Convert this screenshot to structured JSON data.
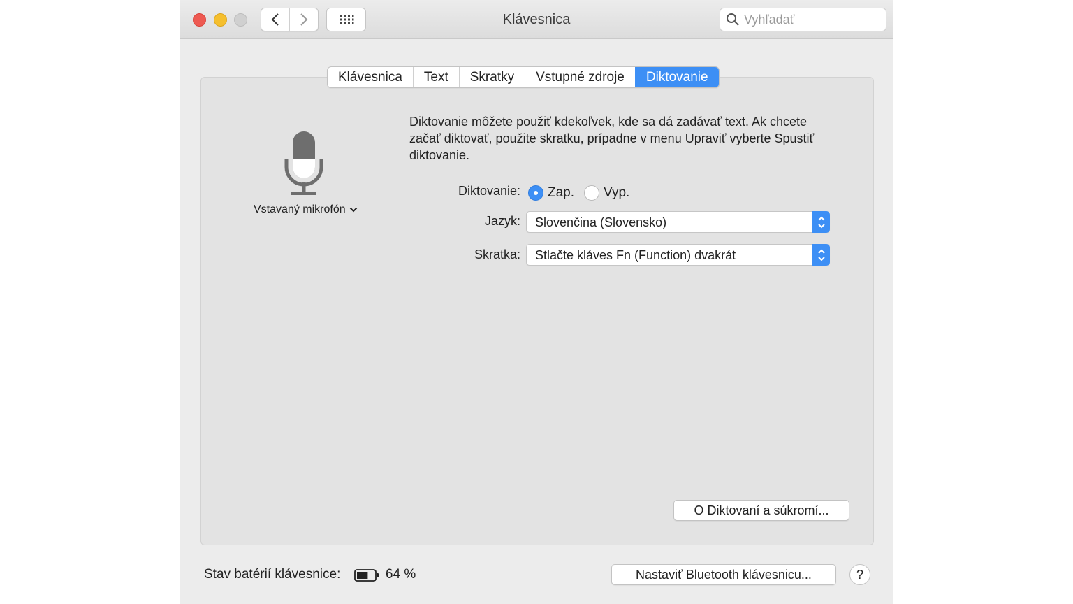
{
  "window": {
    "title": "Klávesnica",
    "search_placeholder": "Vyhľadať"
  },
  "tabs": [
    {
      "label": "Klávesnica"
    },
    {
      "label": "Text"
    },
    {
      "label": "Skratky"
    },
    {
      "label": "Vstupné zdroje"
    },
    {
      "label": "Diktovanie",
      "active": true
    }
  ],
  "microphone": {
    "label": "Vstavaný mikrofón"
  },
  "description": "Diktovanie môžete použiť kdekoľvek, kde sa dá zadávať text. Ak chcete začať diktovať, použite skratku, prípadne v menu Upraviť vyberte Spustiť diktovanie.",
  "dictation": {
    "label": "Diktovanie:",
    "on_label": "Zap.",
    "off_label": "Vyp.",
    "selected": "on"
  },
  "language": {
    "label": "Jazyk:",
    "value": "Slovenčina (Slovensko)"
  },
  "shortcut": {
    "label": "Skratka:",
    "value": "Stlačte kláves Fn (Function) dvakrát"
  },
  "privacy_button": "O Diktovaní a súkromí...",
  "footer": {
    "battery_label": "Stav batérií klávesnice:",
    "battery_percent": "64 %",
    "battery_level": 0.64,
    "bluetooth_button": "Nastaviť Bluetooth klávesnicu...",
    "help": "?"
  },
  "colors": {
    "accent": "#3d8ff5",
    "close": "#ee5a52",
    "minimize": "#f5bf2e"
  }
}
